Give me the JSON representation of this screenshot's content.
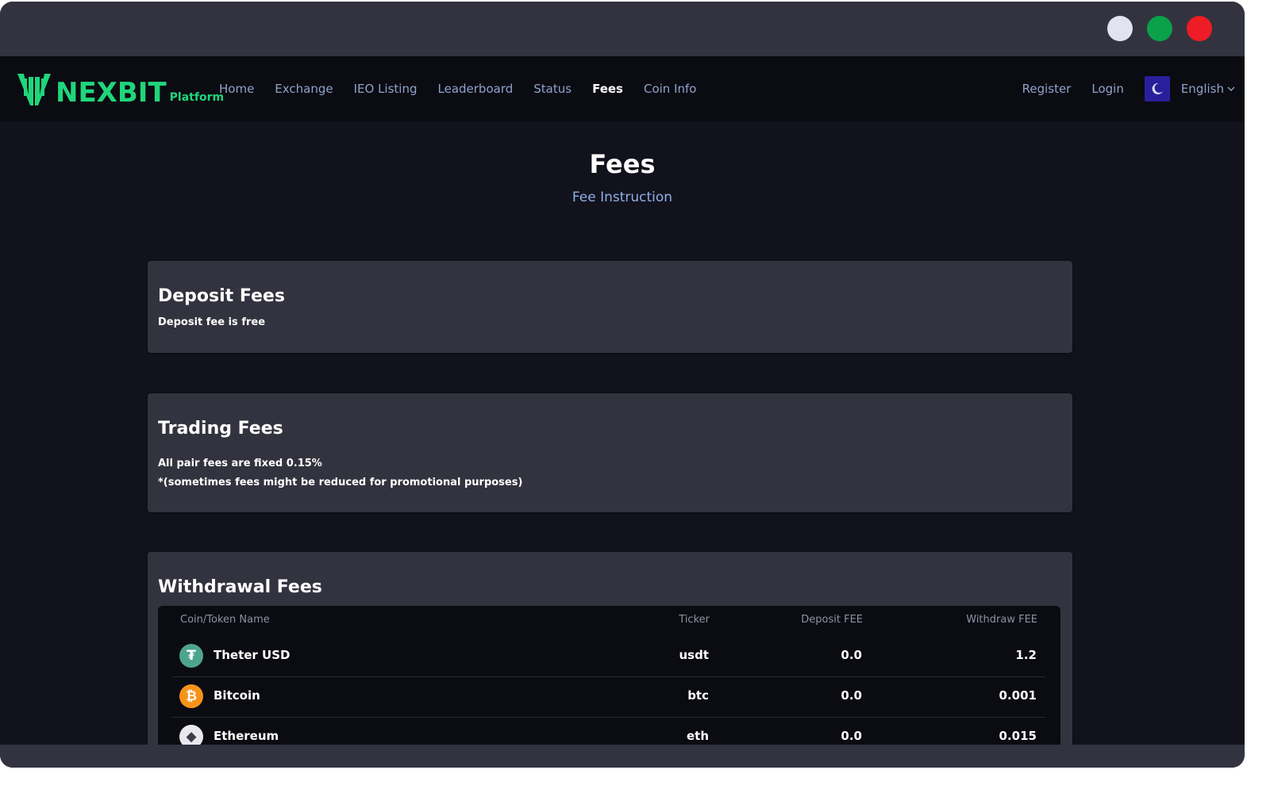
{
  "window": {
    "controls": [
      {
        "name": "minimize",
        "color": "#e2e3ef"
      },
      {
        "name": "maximize",
        "color": "#0aa14a"
      },
      {
        "name": "close",
        "color": "#ee1c24"
      }
    ]
  },
  "brand": {
    "name": "NEXBIT",
    "sub": "Platform",
    "color": "#1fd67a"
  },
  "nav": {
    "links": [
      {
        "label": "Home",
        "active": false
      },
      {
        "label": "Exchange",
        "active": false
      },
      {
        "label": "IEO Listing",
        "active": false
      },
      {
        "label": "Leaderboard",
        "active": false
      },
      {
        "label": "Status",
        "active": false
      },
      {
        "label": "Fees",
        "active": true
      },
      {
        "label": "Coin Info",
        "active": false
      }
    ],
    "register": "Register",
    "login": "Login",
    "theme_icon": "moon-icon",
    "language": "English"
  },
  "page": {
    "title": "Fees",
    "subtitle": "Fee Instruction"
  },
  "deposit": {
    "title": "Deposit Fees",
    "text": "Deposit fee is free"
  },
  "trading": {
    "title": "Trading Fees",
    "line1": "All pair fees are fixed 0.15%",
    "line2": "*(sometimes fees might be reduced for promotional purposes)"
  },
  "withdrawal": {
    "title": "Withdrawal Fees",
    "headers": {
      "name": "Coin/Token Name",
      "ticker": "Ticker",
      "deposit": "Deposit FEE",
      "withdraw": "Withdraw FEE"
    },
    "rows": [
      {
        "name": "Theter USD",
        "ticker": "usdt",
        "deposit": "0.0",
        "withdraw": "1.2",
        "icon": "tether-icon",
        "icon_color": "#4fa48f",
        "icon_glyph": "₮"
      },
      {
        "name": "Bitcoin",
        "ticker": "btc",
        "deposit": "0.0",
        "withdraw": "0.001",
        "icon": "bitcoin-icon",
        "icon_color": "#f7931a",
        "icon_glyph": "₿"
      },
      {
        "name": "Ethereum",
        "ticker": "eth",
        "deposit": "0.0",
        "withdraw": "0.015",
        "icon": "ethereum-icon",
        "icon_color": "#e8e8ee",
        "icon_glyph": "◆"
      }
    ]
  }
}
